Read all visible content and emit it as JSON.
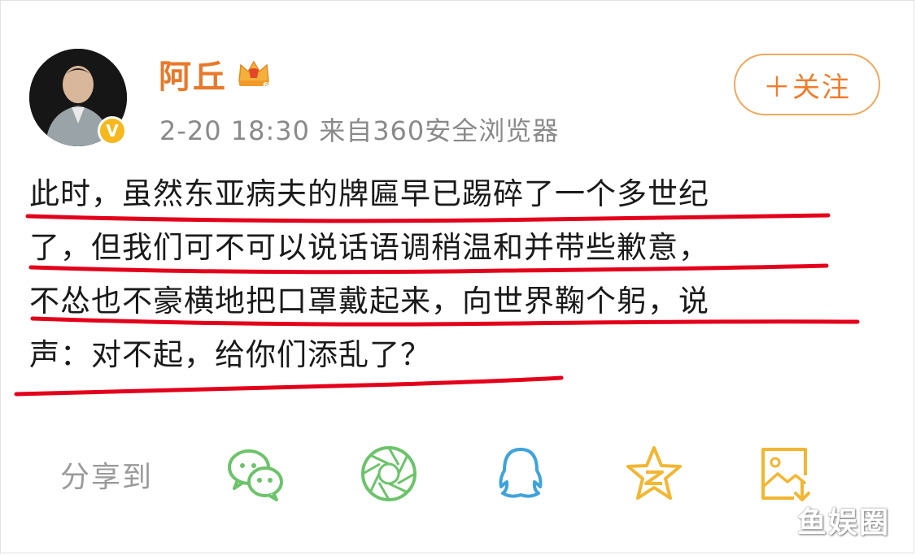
{
  "post": {
    "username": "阿丘",
    "meta": "2-20 18:30 来自360安全浏览器",
    "follow_label": "＋关注",
    "body_lines": [
      "此时，虽然东亚病夫的牌匾早已踢碎了一个多世纪",
      "了，但我们可不可以说话语调稍温和并带些歉意，",
      "不怂也不豪横地把口罩戴起来，向世界鞠个躬，说",
      "声：对不起，给你们添乱了？"
    ]
  },
  "share": {
    "label": "分享到",
    "targets": [
      "wechat-icon",
      "moments-icon",
      "qq-icon",
      "qzone-icon",
      "save-image-icon"
    ]
  },
  "badges": {
    "verified_icon": "verified-v-icon",
    "verified_mark": "V",
    "vip_icon": "crown-vip-icon",
    "vip_level": "6"
  },
  "watermark": "鱼娱圈",
  "colors": {
    "username": "#e8792a",
    "follow": "#ef7d2c",
    "underline": "#e3001b",
    "icon_green": "#6cc36a",
    "icon_blue": "#3fa2dc",
    "icon_gold": "#f2b632"
  }
}
